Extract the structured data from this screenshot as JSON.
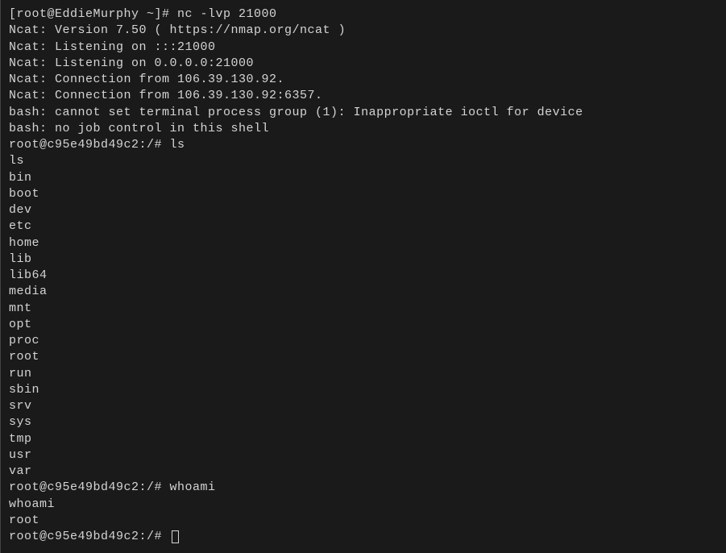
{
  "terminal": {
    "lines": [
      "[root@EddieMurphy ~]# nc -lvp 21000",
      "Ncat: Version 7.50 ( https://nmap.org/ncat )",
      "Ncat: Listening on :::21000",
      "Ncat: Listening on 0.0.0.0:21000",
      "Ncat: Connection from 106.39.130.92.",
      "Ncat: Connection from 106.39.130.92:6357.",
      "bash: cannot set terminal process group (1): Inappropriate ioctl for device",
      "bash: no job control in this shell",
      "root@c95e49bd49c2:/# ls",
      "ls",
      "bin",
      "boot",
      "dev",
      "etc",
      "home",
      "lib",
      "lib64",
      "media",
      "mnt",
      "opt",
      "proc",
      "root",
      "run",
      "sbin",
      "srv",
      "sys",
      "tmp",
      "usr",
      "var",
      "root@c95e49bd49c2:/# whoami",
      "whoami",
      "root",
      "root@c95e49bd49c2:/# "
    ]
  }
}
